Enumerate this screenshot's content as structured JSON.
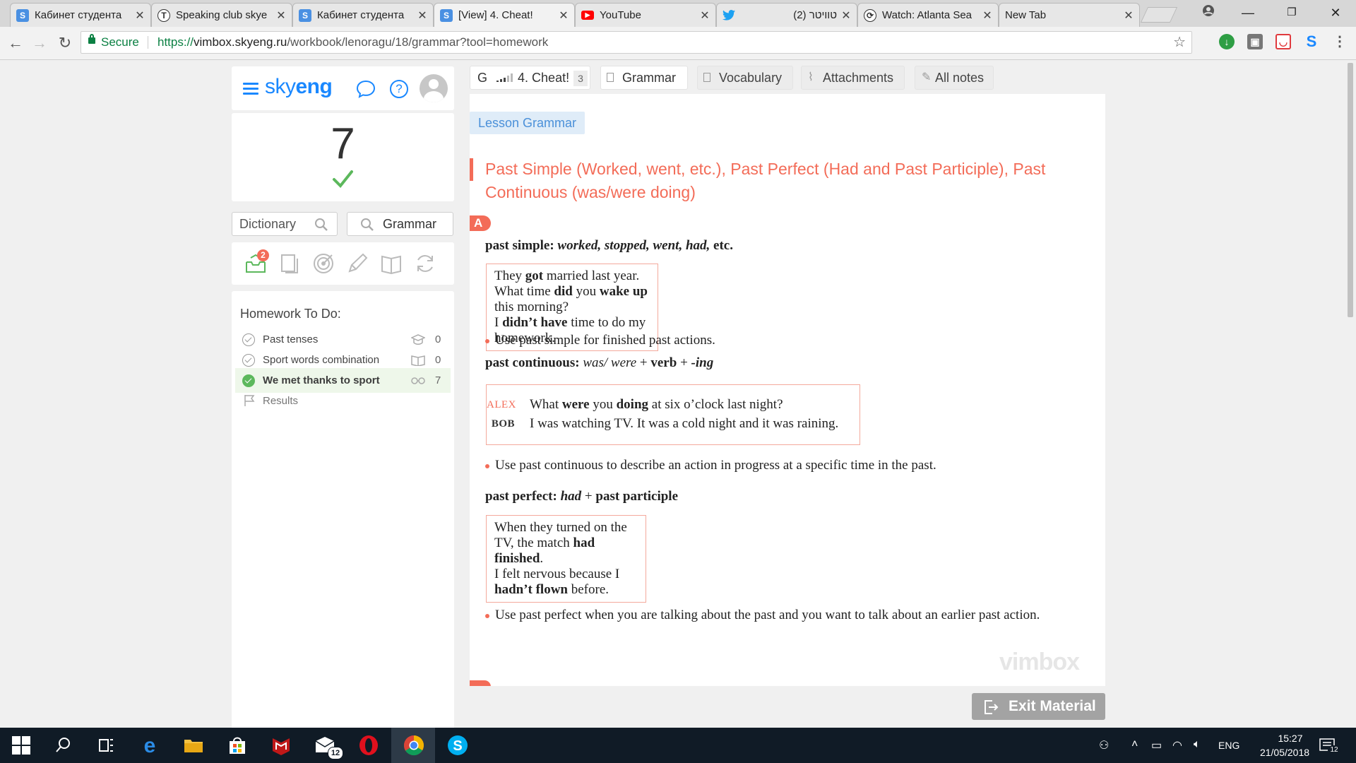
{
  "browser": {
    "tabs": [
      {
        "title": "Кабинет студента",
        "favicon": "skyeng-s-icon",
        "favcolor": "#4a90e2",
        "fav": "S"
      },
      {
        "title": "Speaking club skye",
        "favicon": "typeform-icon",
        "favcolor": "#ffffff",
        "fav": "T"
      },
      {
        "title": "Кабинет студента",
        "favicon": "skyeng-s-icon",
        "favcolor": "#4a90e2",
        "fav": "S"
      },
      {
        "title": "[View] 4. Cheat!",
        "favicon": "skyeng-s-icon",
        "favcolor": "#4a90e2",
        "fav": "S"
      },
      {
        "title": "YouTube",
        "favicon": "youtube-icon",
        "favcolor": "#ff0000",
        "fav": "▶"
      },
      {
        "title": "טוויטר (2)",
        "favicon": "twitter-icon",
        "favcolor": "#1da1f2",
        "fav": "🐦"
      },
      {
        "title": "Watch: Atlanta Sea",
        "favicon": "watch-icon",
        "favcolor": "#ffffff",
        "fav": "⟳"
      },
      {
        "title": "New Tab",
        "favicon": "",
        "favcolor": "",
        "fav": ""
      }
    ],
    "secure_label": "Secure",
    "url_proto": "https://",
    "url_host": "vimbox.skyeng.ru",
    "url_path": "/workbook/lenoragu/18/grammar?tool=homework"
  },
  "sidebar": {
    "logo_light": "sky",
    "logo_bold": "eng",
    "score": "7",
    "dictionary_label": "Dictionary",
    "grammar_label": "Grammar",
    "tools_badge": "2",
    "homework_title": "Homework To Do:",
    "homework": [
      {
        "label": "Past tenses",
        "count": "0",
        "done": false,
        "kind": "cap-icon"
      },
      {
        "label": "Sport words combination",
        "count": "0",
        "done": false,
        "kind": "book-icon"
      },
      {
        "label": "We met thanks to sport",
        "count": "7",
        "done": true,
        "kind": "glasses-icon"
      }
    ],
    "results_label": "Results"
  },
  "material_tabs": {
    "lesson_prefix": "G",
    "lesson_name": "4. Cheat!",
    "lesson_count": "3",
    "grammar": "Grammar",
    "vocabulary": "Vocabulary",
    "attachments": "Attachments",
    "all_notes": "All notes"
  },
  "lesson": {
    "tag": "Lesson Grammar",
    "title": "Past Simple (Worked, went, etc.), Past Perfect (Had and Past Participle), Past Continuous (was/were doing)",
    "section_a": "A",
    "past_simple": {
      "head": "past simple:",
      "forms": "worked, stopped, went, had,",
      "tail": "etc.",
      "bullet": "Use past simple for finished past actions."
    },
    "past_continuous": {
      "head": "past continuous:",
      "f1": "was/ were",
      "plus1": "+",
      "f2": "verb",
      "plus2": "+",
      "f3": "-ing",
      "speaker1": "ALEX",
      "speaker2": "BOB",
      "line2": "I was watching TV. It was a cold night and it was raining.",
      "bullet": "Use past continuous to describe an action in progress at a specific time in the past."
    },
    "past_perfect": {
      "head": "past perfect:",
      "f1": "had",
      "plus": "+",
      "f2": "past participle",
      "bullet": "Use past perfect when you are talking about the past and you want to talk about an earlier past action."
    },
    "watermark": "vimbox"
  },
  "exit_label": "Exit Material",
  "taskbar": {
    "lang": "ENG",
    "time": "15:27",
    "date": "21/05/2018",
    "mail_badge": "12",
    "notif_badge": "12"
  },
  "colors": {
    "brand_blue": "#1a88ff",
    "accent_red": "#f36c58",
    "success_green": "#5cb85c"
  }
}
